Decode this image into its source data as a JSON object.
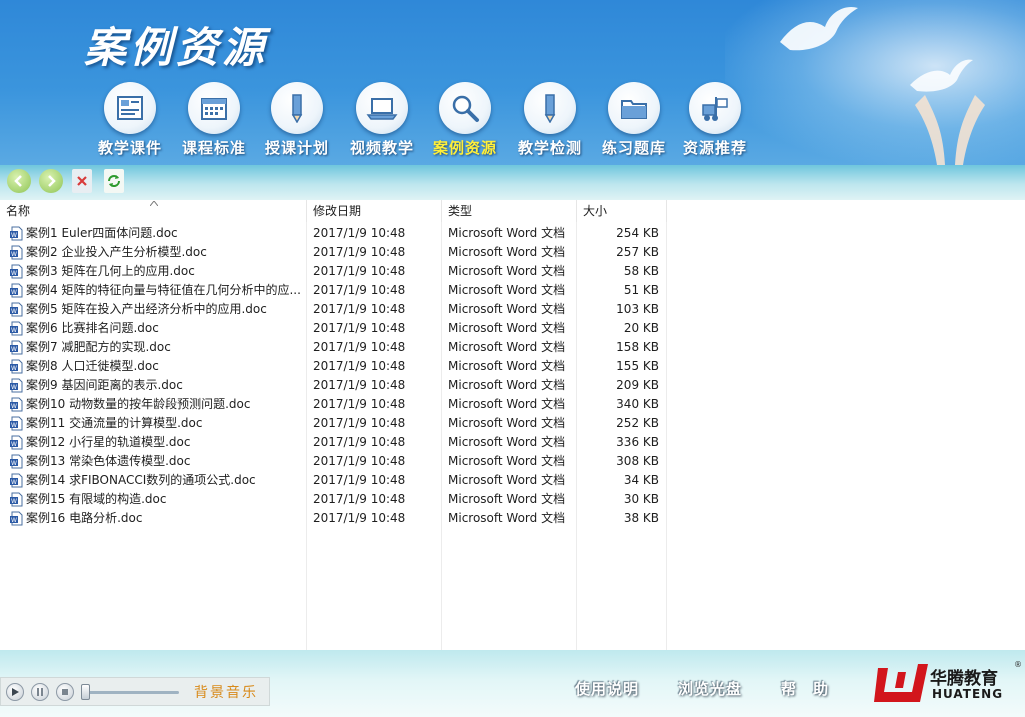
{
  "header": {
    "brand": "案例资源",
    "nav": [
      {
        "label": "教学课件",
        "icon": "courseware-icon"
      },
      {
        "label": "课程标准",
        "icon": "calendar-icon"
      },
      {
        "label": "授课计划",
        "icon": "pencil-icon"
      },
      {
        "label": "视频教学",
        "icon": "laptop-icon"
      },
      {
        "label": "案例资源",
        "icon": "magnifier-icon",
        "active": true
      },
      {
        "label": "教学检测",
        "icon": "pencil-icon"
      },
      {
        "label": "练习题库",
        "icon": "folder-icon"
      },
      {
        "label": "资源推荐",
        "icon": "forklift-icon"
      }
    ]
  },
  "toolbar": {
    "buttons": [
      "back-icon",
      "forward-icon",
      "delete-icon",
      "refresh-icon"
    ]
  },
  "file_list": {
    "columns": [
      "名称",
      "修改日期",
      "类型",
      "大小"
    ],
    "rows": [
      {
        "name": "案例1 Euler四面体问题.doc",
        "date": "2017/1/9 10:48",
        "type": "Microsoft Word 文档",
        "size": "254 KB"
      },
      {
        "name": "案例2 企业投入产生分析模型.doc",
        "date": "2017/1/9 10:48",
        "type": "Microsoft Word 文档",
        "size": "257 KB"
      },
      {
        "name": "案例3 矩阵在几何上的应用.doc",
        "date": "2017/1/9 10:48",
        "type": "Microsoft Word 文档",
        "size": "58 KB"
      },
      {
        "name": "案例4 矩阵的特征向量与特征值在几何分析中的应...",
        "date": "2017/1/9 10:48",
        "type": "Microsoft Word 文档",
        "size": "51 KB"
      },
      {
        "name": "案例5 矩阵在投入产出经济分析中的应用.doc",
        "date": "2017/1/9 10:48",
        "type": "Microsoft Word 文档",
        "size": "103 KB"
      },
      {
        "name": "案例6 比赛排名问题.doc",
        "date": "2017/1/9 10:48",
        "type": "Microsoft Word 文档",
        "size": "20 KB"
      },
      {
        "name": "案例7 减肥配方的实现.doc",
        "date": "2017/1/9 10:48",
        "type": "Microsoft Word 文档",
        "size": "158 KB"
      },
      {
        "name": "案例8 人口迁徙模型.doc",
        "date": "2017/1/9 10:48",
        "type": "Microsoft Word 文档",
        "size": "155 KB"
      },
      {
        "name": "案例9 基因间距离的表示.doc",
        "date": "2017/1/9 10:48",
        "type": "Microsoft Word 文档",
        "size": "209 KB"
      },
      {
        "name": "案例10 动物数量的按年龄段预测问题.doc",
        "date": "2017/1/9 10:48",
        "type": "Microsoft Word 文档",
        "size": "340 KB"
      },
      {
        "name": "案例11 交通流量的计算模型.doc",
        "date": "2017/1/9 10:48",
        "type": "Microsoft Word 文档",
        "size": "252 KB"
      },
      {
        "name": "案例12 小行星的轨道模型.doc",
        "date": "2017/1/9 10:48",
        "type": "Microsoft Word 文档",
        "size": "336 KB"
      },
      {
        "name": "案例13 常染色体遗传模型.doc",
        "date": "2017/1/9 10:48",
        "type": "Microsoft Word 文档",
        "size": "308 KB"
      },
      {
        "name": "案例14 求FIBONACCI数列的通项公式.doc",
        "date": "2017/1/9 10:48",
        "type": "Microsoft Word 文档",
        "size": "34 KB"
      },
      {
        "name": "案例15 有限域的构造.doc",
        "date": "2017/1/9 10:48",
        "type": "Microsoft Word 文档",
        "size": "30 KB"
      },
      {
        "name": "案例16 电路分析.doc",
        "date": "2017/1/9 10:48",
        "type": "Microsoft Word 文档",
        "size": "38 KB"
      }
    ]
  },
  "player": {
    "label": "背景音乐"
  },
  "footer": {
    "links": [
      "使用说明",
      "浏览光盘",
      "帮　助"
    ],
    "logo_cn": "华腾教育",
    "logo_en": "HUATENG"
  },
  "colors": {
    "header": "#3b95dd",
    "active_nav": "#ffef3a",
    "music_label": "#d88a1a",
    "logo_red": "#d2161c"
  }
}
